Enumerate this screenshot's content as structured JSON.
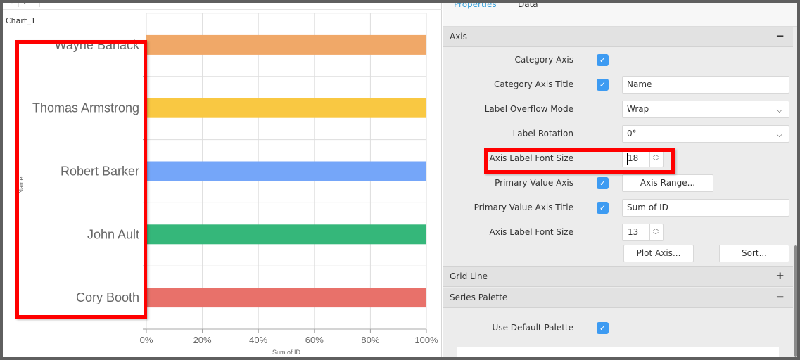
{
  "chart_panel": {
    "title": "Chart_1",
    "toolbar_icons": [
      "pin-icon",
      "expand-icon",
      "more-icon"
    ]
  },
  "chart_data": {
    "type": "bar",
    "orientation": "horizontal",
    "stacked": "100%",
    "categories": [
      "Wayne Banack",
      "Thomas Armstrong",
      "Robert Barker",
      "John Ault",
      "Cory Booth"
    ],
    "values": [
      100,
      100,
      100,
      100,
      100
    ],
    "colors": [
      "#f0a868",
      "#f9c842",
      "#75a6f9",
      "#35b77a",
      "#e8716a"
    ],
    "xlabel": "Sum of ID",
    "ylabel": "Name",
    "x_ticks": [
      "0%",
      "20%",
      "40%",
      "60%",
      "80%",
      "100%"
    ],
    "xlim": [
      0,
      100
    ],
    "grid": true,
    "category_label_font_size": 18,
    "value_label_font_size": 13
  },
  "properties_panel": {
    "tabs": [
      {
        "label": "Properties",
        "active": true
      },
      {
        "label": "Data",
        "active": false
      }
    ],
    "sections": {
      "axis": {
        "title": "Axis",
        "toggle": "−",
        "category_axis": {
          "label": "Category Axis",
          "checked": true
        },
        "category_axis_title": {
          "label": "Category Axis Title",
          "checked": true,
          "value": "Name"
        },
        "label_overflow_mode": {
          "label": "Label Overflow Mode",
          "value": "Wrap"
        },
        "label_rotation": {
          "label": "Label Rotation",
          "value": "0°"
        },
        "category_axis_label_font_size": {
          "label": "Axis Label Font Size",
          "value": "18"
        },
        "primary_value_axis": {
          "label": "Primary Value Axis",
          "checked": true,
          "button": "Axis Range..."
        },
        "primary_value_axis_title": {
          "label": "Primary Value Axis Title",
          "checked": true,
          "value": "Sum of ID"
        },
        "value_axis_label_font_size": {
          "label": "Axis Label Font Size",
          "value": "13"
        },
        "plot_axis_button": "Plot Axis...",
        "sort_button": "Sort..."
      },
      "grid_line": {
        "title": "Grid Line",
        "toggle": "+"
      },
      "series_palette": {
        "title": "Series Palette",
        "toggle": "−",
        "use_default_palette": {
          "label": "Use Default Palette",
          "checked": true
        }
      }
    }
  }
}
